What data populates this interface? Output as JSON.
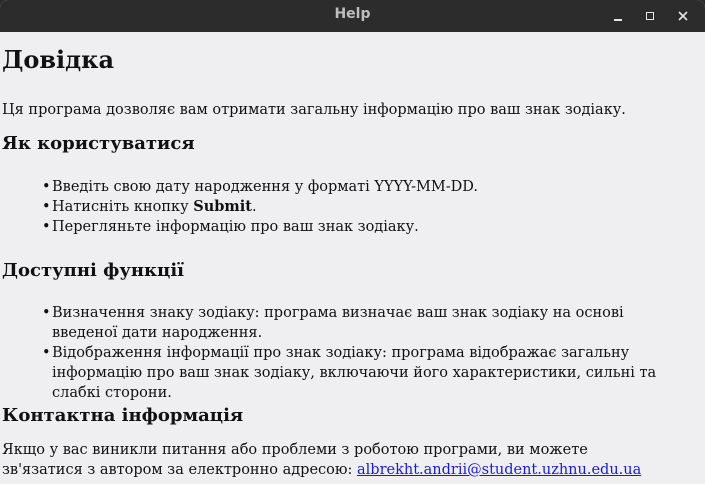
{
  "window": {
    "title": "Help",
    "minimize_label": "minimize",
    "maximize_label": "maximize",
    "close_label": "close"
  },
  "help": {
    "heading": "Довідка",
    "intro": "Ця програма дозволяє вам отримати загальну інформацію про ваш знак зодіаку.",
    "how_to_use": {
      "heading": "Як користуватися",
      "steps": [
        {
          "text": "Введіть свою дату народження у форматі YYYY-MM-DD."
        },
        {
          "text_before": "Натисніть кнопку ",
          "bold": "Submit",
          "text_after": "."
        },
        {
          "text": "Перегляньте інформацію про ваш знак зодіаку."
        }
      ]
    },
    "features": {
      "heading": "Доступні функції",
      "items": [
        "Визначення знаку зодіаку: програма визначає ваш знак зодіаку на основі введеної дати народження.",
        "Відображення інформації про знак зодіаку: програма відображає загальну інформацію про ваш знак зодіаку, включаючи його характеристики, сильні та слабкі сторони."
      ]
    },
    "contact": {
      "heading": "Контактна інформація",
      "text": "Якщо у вас виникли питання або проблеми з роботою програми, ви можете зв'язатися з автором за електронно адресою: ",
      "email": "albrekht.andrii@student.uzhnu.edu.ua"
    }
  }
}
